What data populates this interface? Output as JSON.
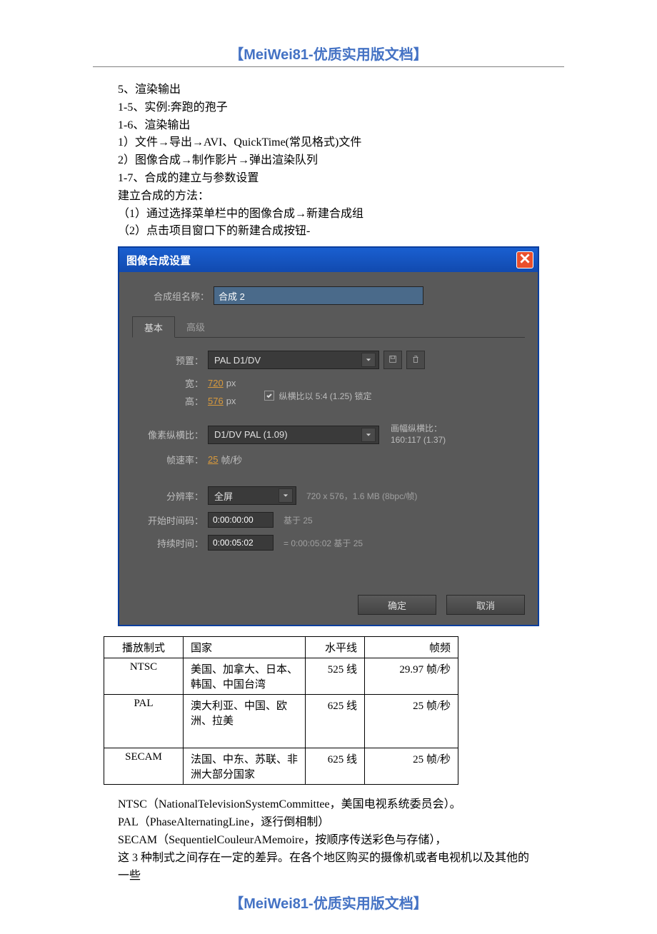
{
  "header": "【MeiWei81-优质实用版文档】",
  "footer": "【MeiWei81-优质实用版文档】",
  "body_lines": [
    "5、渲染输出",
    "1-5、实例:奔跑的孢子",
    "1-6、渲染输出",
    "1）文件→导出→AVI、QuickTime(常见格式)文件",
    "2）图像合成→制作影片→弹出渲染队列",
    "1-7、合成的建立与参数设置",
    "建立合成的方法：",
    "（1）通过选择菜单栏中的图像合成→新建合成组",
    "（2）点击项目窗口下的新建合成按钮-"
  ],
  "dialog": {
    "title": "图像合成设置",
    "comp_name_label": "合成组名称：",
    "comp_name_value": "合成 2",
    "tab_basic": "基本",
    "tab_advanced": "高级",
    "preset_label": "预置：",
    "preset_value": "PAL D1/DV",
    "width_label": "宽：",
    "width_value": "720",
    "height_label": "高：",
    "height_value": "576",
    "px": "px",
    "lock_aspect": "纵横比以 5:4 (1.25) 锁定",
    "par_label": "像素纵横比：",
    "par_value": "D1/DV PAL (1.09)",
    "frame_aspect_label": "画幅纵横比：",
    "frame_aspect_value": "160:117 (1.37)",
    "fps_label": "帧速率：",
    "fps_value": "25",
    "fps_unit": "帧/秒",
    "res_label": "分辨率：",
    "res_value": "全屏",
    "res_hint": "720 x 576，1.6 MB (8bpc/帧)",
    "start_label": "开始时间码：",
    "start_value": "0:00:00:00",
    "start_hint": "基于 25",
    "dur_label": "持续时间：",
    "dur_value": "0:00:05:02",
    "dur_hint": "= 0:00:05:02 基于 25",
    "ok": "确定",
    "cancel": "取消"
  },
  "table": {
    "headers": [
      "播放制式",
      "国家",
      "水平线",
      "帧频"
    ],
    "rows": [
      {
        "fmt": "NTSC",
        "country": "美国、加拿大、日本、韩国、中国台湾",
        "lines": "525 线",
        "freq": "29.97 帧/秒"
      },
      {
        "fmt": "PAL",
        "country": "澳大利亚、中国、欧洲、拉美",
        "lines": "625 线",
        "freq": "25 帧/秒"
      },
      {
        "fmt": "SECAM",
        "country": "法国、中东、苏联、非洲大部分国家",
        "lines": "625 线",
        "freq": "25 帧/秒"
      }
    ]
  },
  "notes": [
    "NTSC（NationalTelevisionSystemCommittee，美国电视系统委员会）。",
    "PAL（PhaseAlternatingLine，逐行倒相制）",
    "SECAM（SequentielCouleurAMemoire，按顺序传送彩色与存储），",
    "这 3 种制式之间存在一定的差异。在各个地区购买的摄像机或者电视机以及其他的一些"
  ]
}
